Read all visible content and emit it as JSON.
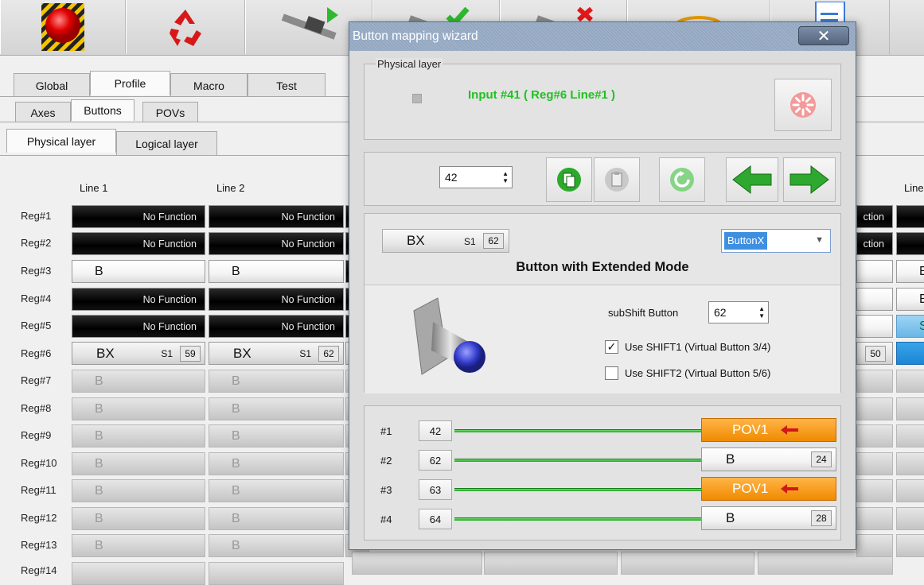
{
  "tabs_main": [
    "Global",
    "Profile",
    "Macro",
    "Test"
  ],
  "tabs_sub": [
    "Axes",
    "Buttons",
    "POVs"
  ],
  "tabs_layer": [
    "Physical layer",
    "Logical layer"
  ],
  "col_headers": [
    "Line 1",
    "Line 2",
    "Line"
  ],
  "regs": [
    "Reg#1",
    "Reg#2",
    "Reg#3",
    "Reg#4",
    "Reg#5",
    "Reg#6",
    "Reg#7",
    "Reg#8",
    "Reg#9",
    "Reg#10",
    "Reg#11",
    "Reg#12",
    "Reg#13",
    "Reg#14"
  ],
  "grid": {
    "no_function": "No Function",
    "b": "B",
    "bx": "BX",
    "s1": "S1",
    "reg6_line1_num": "59",
    "reg6_line2_num": "62",
    "right_partial_ction": "ction",
    "right_partial_num": "50",
    "right_partial_b": "E",
    "right_partial_s": "S"
  },
  "dialog": {
    "title": "Button mapping wizard",
    "close": "✕",
    "physical": {
      "group_label": "Physical layer",
      "input_text": "Input #41 ( Reg#6  Line#1 )"
    },
    "nav": {
      "spin_value": "42"
    },
    "function": {
      "chip_label": "BX",
      "chip_s1": "S1",
      "chip_num": "62",
      "dropdown_value": "ButtonX",
      "title": "Button  with Extended Mode",
      "subshift_label": "subShift Button",
      "subshift_value": "62",
      "shift1_label": "Use SHIFT1 (Virtual Button 3/4)",
      "shift1_checked": true,
      "shift2_label": "Use SHIFT2 (Virtual Button 5/6)",
      "shift2_checked": false
    },
    "mapping": [
      {
        "label": "#1",
        "num": "42",
        "target": "POV1",
        "kind": "pov"
      },
      {
        "label": "#2",
        "num": "62",
        "target": "B",
        "kind": "btn",
        "tnum": "24"
      },
      {
        "label": "#3",
        "num": "63",
        "target": "POV1",
        "kind": "pov"
      },
      {
        "label": "#4",
        "num": "64",
        "target": "B",
        "kind": "btn",
        "tnum": "28"
      }
    ]
  },
  "colors": {
    "accent_green": "#22c022",
    "orange": "#f08a00",
    "title_blue": "#8fa3bd",
    "dropdown_blue": "#3e8fe0"
  }
}
